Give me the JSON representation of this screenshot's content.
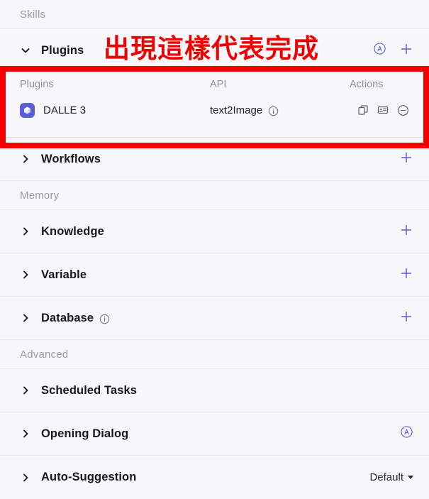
{
  "groups": {
    "skills": "Skills",
    "memory": "Memory",
    "advanced": "Advanced"
  },
  "annotation": {
    "text": "出現這樣代表完成",
    "color": "#ee0000",
    "box_color": "#f40000"
  },
  "plugins_section": {
    "title": "Plugins",
    "chevron": "chevron-down",
    "auto_icon": "circle-a-icon",
    "add_icon": "plus-icon",
    "table": {
      "headers": [
        "Plugins",
        "API",
        "Actions"
      ],
      "rows": [
        {
          "name": "DALLE 3",
          "icon": "plugin-cube-icon",
          "icon_color": "#5b5fd6",
          "api": "text2Image",
          "api_info_icon": "info-icon",
          "actions": [
            "copy-icon",
            "card-preview-icon",
            "remove-icon"
          ]
        }
      ]
    }
  },
  "sections": [
    {
      "id": "workflows",
      "title": "Workflows",
      "chevron": "chevron-right",
      "has_add": true,
      "has_info": false,
      "has_auto": false,
      "value": ""
    },
    {
      "id": "knowledge",
      "title": "Knowledge",
      "chevron": "chevron-right",
      "has_add": true,
      "has_info": false,
      "has_auto": false,
      "value": ""
    },
    {
      "id": "variable",
      "title": "Variable",
      "chevron": "chevron-right",
      "has_add": true,
      "has_info": false,
      "has_auto": false,
      "value": ""
    },
    {
      "id": "database",
      "title": "Database",
      "chevron": "chevron-right",
      "has_add": true,
      "has_info": true,
      "has_auto": false,
      "value": ""
    },
    {
      "id": "scheduled-tasks",
      "title": "Scheduled Tasks",
      "chevron": "chevron-right",
      "has_add": false,
      "has_info": false,
      "has_auto": false,
      "value": ""
    },
    {
      "id": "opening-dialog",
      "title": "Opening Dialog",
      "chevron": "chevron-right",
      "has_add": false,
      "has_info": false,
      "has_auto": true,
      "value": ""
    },
    {
      "id": "auto-suggestion",
      "title": "Auto-Suggestion",
      "chevron": "chevron-right",
      "has_add": false,
      "has_info": false,
      "has_auto": false,
      "value": "Default"
    }
  ]
}
